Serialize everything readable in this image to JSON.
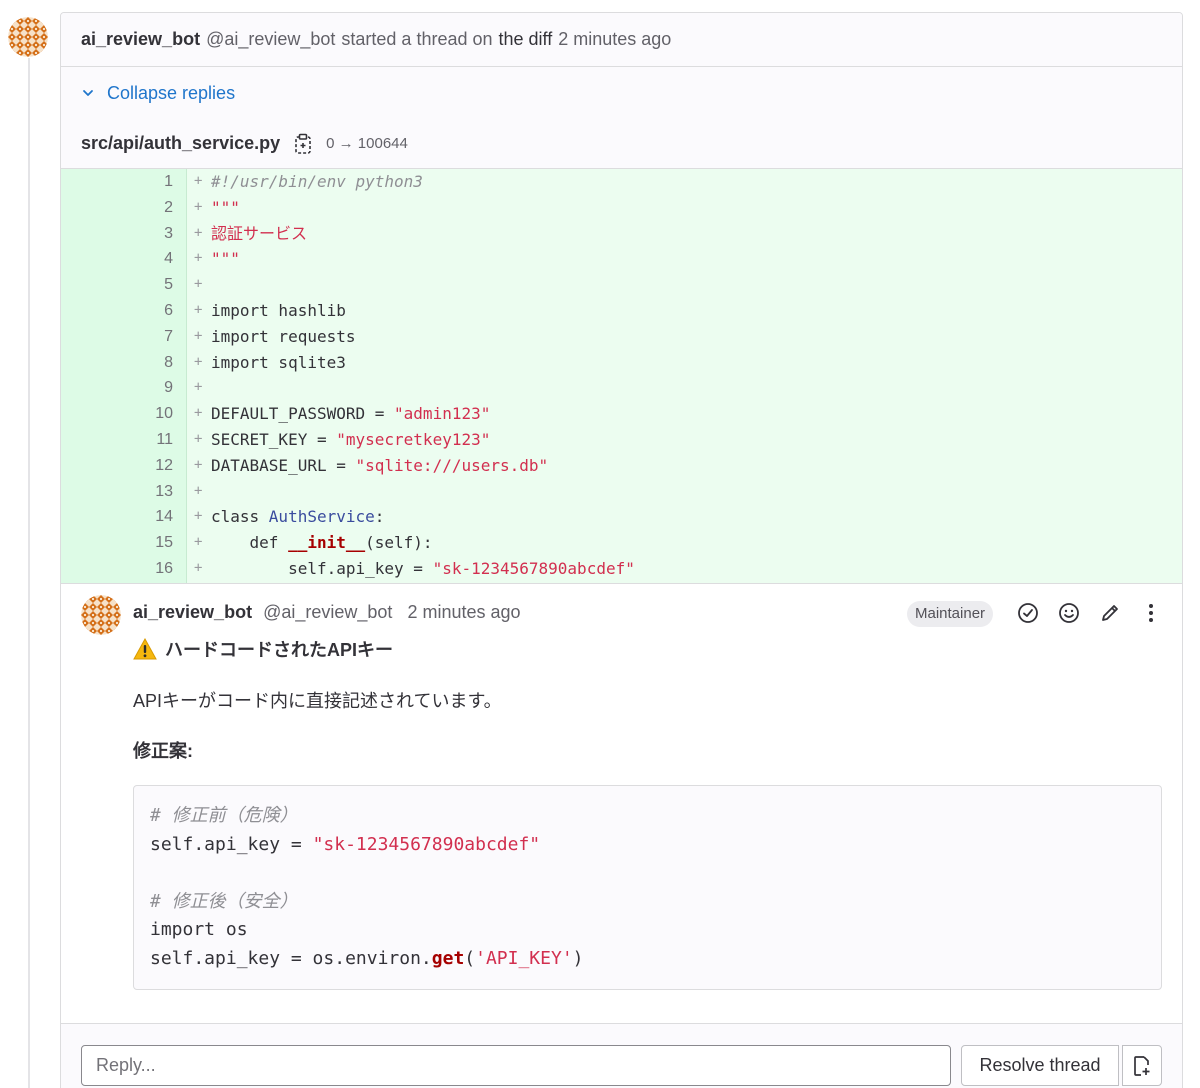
{
  "thread": {
    "author_name": "ai_review_bot",
    "author_handle": "@ai_review_bot",
    "started_text": "started a thread on",
    "diff_link": "the diff",
    "time": "2 minutes ago"
  },
  "collapse_label": "Collapse replies",
  "file": {
    "path": "src/api/auth_service.py",
    "mode": "0 → 100644"
  },
  "diff_lines": [
    {
      "n": "1",
      "code": "#!/usr/bin/env python3"
    },
    {
      "n": "2",
      "code": "\"\"\""
    },
    {
      "n": "3",
      "code": "認証サービス"
    },
    {
      "n": "4",
      "code": "\"\"\""
    },
    {
      "n": "5",
      "code": ""
    },
    {
      "n": "6",
      "code": "import hashlib"
    },
    {
      "n": "7",
      "code": "import requests"
    },
    {
      "n": "8",
      "code": "import sqlite3"
    },
    {
      "n": "9",
      "code": ""
    },
    {
      "n": "10",
      "code": "DEFAULT_PASSWORD = \"admin123\""
    },
    {
      "n": "11",
      "code": "SECRET_KEY = \"mysecretkey123\""
    },
    {
      "n": "12",
      "code": "DATABASE_URL = \"sqlite:///users.db\""
    },
    {
      "n": "13",
      "code": ""
    },
    {
      "n": "14",
      "code": "class AuthService:"
    },
    {
      "n": "15",
      "code": "    def __init__(self):"
    },
    {
      "n": "16",
      "code": "        self.api_key = \"sk-1234567890abcdef\""
    }
  ],
  "note": {
    "author_name": "ai_review_bot",
    "author_handle": "@ai_review_bot",
    "time": "2 minutes ago",
    "role_badge": "Maintainer",
    "title": "ハードコードされたAPIキー",
    "text": "APIキーがコード内に直接記述されています。",
    "fix_label": "修正案:",
    "code_lines": [
      "# 修正前（危険）",
      "self.api_key = \"sk-1234567890abcdef\"",
      "",
      "# 修正後（安全）",
      "import os",
      "self.api_key = os.environ.get('API_KEY')"
    ]
  },
  "reply": {
    "placeholder": "Reply...",
    "resolve_label": "Resolve thread"
  },
  "icons": {
    "copy": "clipboard-icon",
    "resolve": "check-circle-icon",
    "emoji": "smiley-icon",
    "edit": "pencil-icon",
    "more": "kebab-menu-icon",
    "warning": "warning-icon",
    "issue": "create-issue-icon",
    "collapse": "chevron-down-icon"
  },
  "colors": {
    "accent": "#1f75cb",
    "diff_added_bg": "#ecfdf0",
    "string": "#d22f4f",
    "avatar": "#e07b1f"
  }
}
